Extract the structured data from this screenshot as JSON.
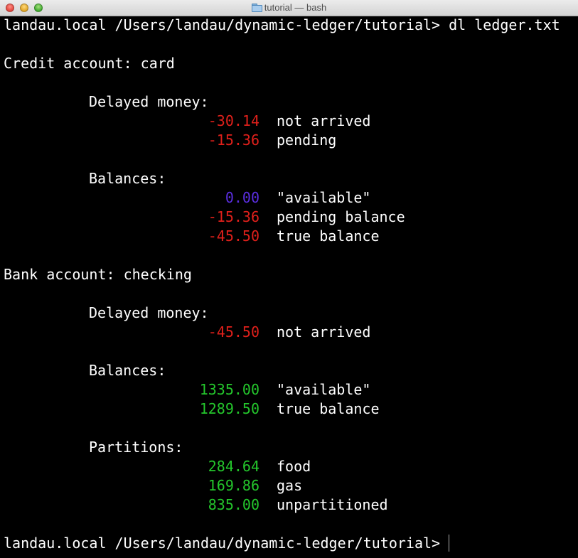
{
  "window": {
    "title": "tutorial — bash",
    "folder_icon": "folder-icon"
  },
  "terminal": {
    "command_line": "landau.local /Users/landau/dynamic-ledger/tutorial> dl ledger.txt",
    "credit": {
      "header": "Credit account: card",
      "delayed_title": "Delayed money:",
      "delayed": [
        {
          "amount": "-30.14",
          "label": "not arrived"
        },
        {
          "amount": "-15.36",
          "label": "pending"
        }
      ],
      "balances_title": "Balances:",
      "balances": [
        {
          "amount": "0.00",
          "label": "\"available\""
        },
        {
          "amount": "-15.36",
          "label": "pending balance"
        },
        {
          "amount": "-45.50",
          "label": "true balance"
        }
      ]
    },
    "bank": {
      "header": "Bank account: checking",
      "delayed_title": "Delayed money:",
      "delayed": [
        {
          "amount": "-45.50",
          "label": "not arrived"
        }
      ],
      "balances_title": "Balances:",
      "balances": [
        {
          "amount": "1335.00",
          "label": "\"available\""
        },
        {
          "amount": "1289.50",
          "label": "true balance"
        }
      ],
      "partitions_title": "Partitions:",
      "partitions": [
        {
          "amount": "284.64",
          "label": "food"
        },
        {
          "amount": "169.86",
          "label": "gas"
        },
        {
          "amount": "835.00",
          "label": "unpartitioned"
        }
      ]
    },
    "prompt": "landau.local /Users/landau/dynamic-ledger/tutorial>"
  },
  "colors": {
    "negative": "#e0201b",
    "zero": "#5a2ee0",
    "positive": "#24c72c",
    "text": "#ffffff",
    "background": "#000000"
  }
}
